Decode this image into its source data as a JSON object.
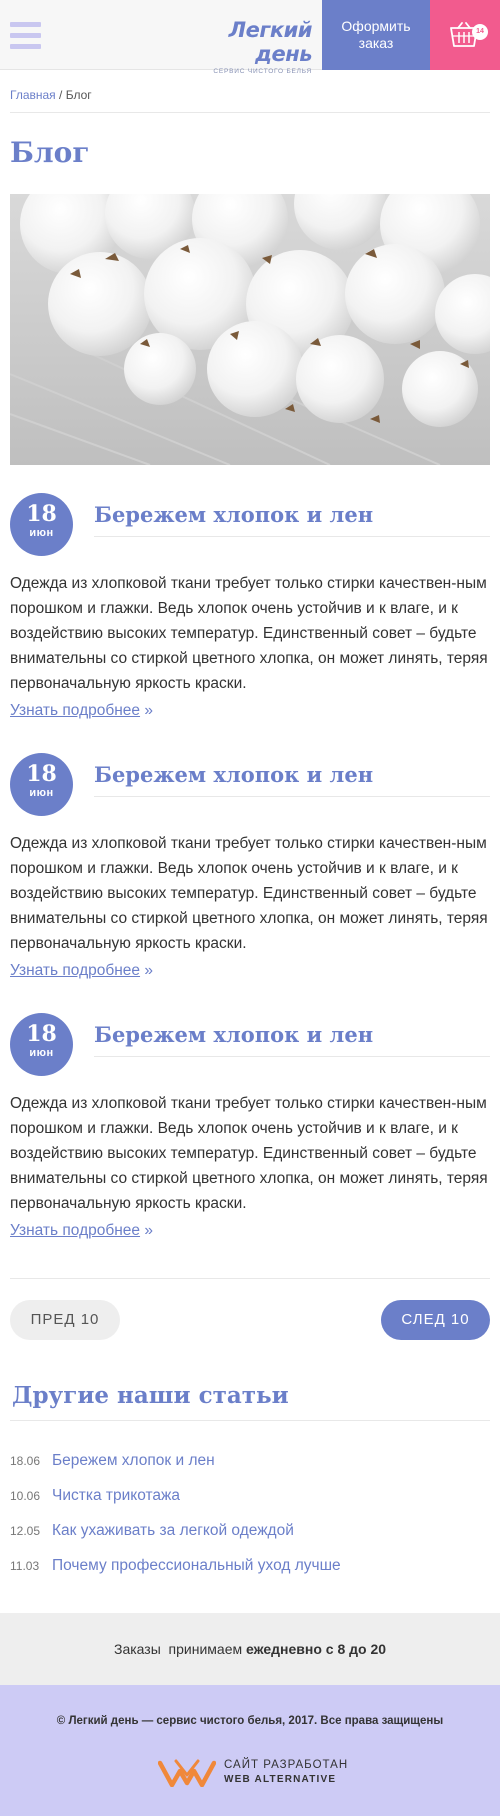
{
  "header": {
    "logo_title": "Легкий день",
    "logo_subtitle": "СЕРВИС ЧИСТОГО БЕЛЬЯ",
    "order_button": "Оформить заказ",
    "cart_count": "14"
  },
  "breadcrumb": {
    "home": "Главная",
    "separator": " / ",
    "current": "Блог"
  },
  "page_title": "Блог",
  "articles": [
    {
      "day": "18",
      "month": "июн",
      "title": "Бережем хлопок и лен",
      "text": "Одежда из хлопковой ткани требует только стирки качествен-ным порошком и глажки. Ведь хлопок очень устойчив и к влаге, и к воздействию высоких температур. Единственный совет – будьте внимательны со стиркой цветного хлопка, он может линять, теряя первоначальную яркость краски.",
      "more_link": "Узнать подробнее",
      "more_arrow": " »"
    },
    {
      "day": "18",
      "month": "июн",
      "title": "Бережем хлопок и лен",
      "text": "Одежда из хлопковой ткани требует только стирки качествен-ным порошком и глажки. Ведь хлопок очень устойчив и к влаге, и к воздействию высоких температур. Единственный совет – будьте внимательны со стиркой цветного хлопка, он может линять, теряя первоначальную яркость краски.",
      "more_link": "Узнать подробнее",
      "more_arrow": " »"
    },
    {
      "day": "18",
      "month": "июн",
      "title": "Бережем хлопок и лен",
      "text": "Одежда из хлопковой ткани требует только стирки качествен-ным порошком и глажки. Ведь хлопок очень устойчив и к влаге, и к воздействию высоких температур. Единственный совет – будьте внимательны со стиркой цветного хлопка, он может линять, теряя первоначальную яркость краски.",
      "more_link": "Узнать подробнее",
      "more_arrow": " »"
    }
  ],
  "pagination": {
    "prev": "ПРЕД 10",
    "next": "СЛЕД 10"
  },
  "other_articles": {
    "title": "Другие наши статьи",
    "items": [
      {
        "date": "18.06",
        "title": "Бережем хлопок и лен"
      },
      {
        "date": "10.06",
        "title": "Чистка трикотажа"
      },
      {
        "date": "12.05",
        "title": "Как ухаживать за легкой одеждой"
      },
      {
        "date": "11.03",
        "title": "Почему профессиональный уход лучше"
      }
    ]
  },
  "info_bar": {
    "prefix": "Заказы  принимаем ",
    "hours": "ежедневно с 8 до 20"
  },
  "footer": {
    "copyright": "© Легкий день — сервис чистого белья, 2017. Все права защищены",
    "dev_line1": "САЙТ РАЗРАБОТАН",
    "dev_line2": "WEB ALTERNATIVE"
  },
  "icons": {
    "menu": "hamburger-icon",
    "cart": "basket-icon",
    "developer_logo": "web-alternative-logo-icon"
  },
  "colors": {
    "accent": "#6b7fc9",
    "cart": "#f25b8e",
    "footer_bg": "#cdcbf5",
    "info_bg": "#eeeeee"
  }
}
